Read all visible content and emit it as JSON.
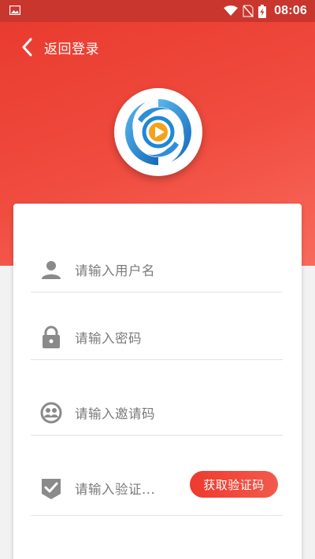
{
  "status_bar": {
    "time": "08:06",
    "icons": [
      "gallery-notification-icon",
      "wifi-icon",
      "no-sim-icon",
      "battery-charging-icon"
    ]
  },
  "nav": {
    "back_label": "返回登录"
  },
  "form": {
    "username_placeholder": "请输入用户名",
    "password_placeholder": "请输入密码",
    "invite_placeholder": "请输入邀请码",
    "verify_placeholder": "请输入验证...",
    "get_code_label": "获取验证码"
  },
  "colors": {
    "brand_red": "#e8392d",
    "icon_gray": "#8a8a8a",
    "logo_blue": "#1e88d6",
    "logo_orange": "#f5a21a"
  }
}
